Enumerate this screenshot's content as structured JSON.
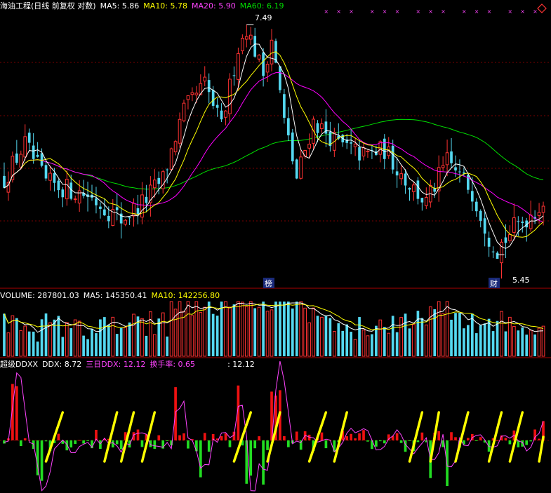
{
  "header": {
    "title": "海油工程(日线 前复权 对数)",
    "ma5": "MA5: 5.86",
    "ma10": "MA10: 5.78",
    "ma20": "MA20: 5.90",
    "ma60": "MA60: 6.19"
  },
  "volume_header": {
    "volume": "VOLUME: 287801.03",
    "ma5": "MA5: 145350.41",
    "ma10": "MA10: 142256.80"
  },
  "ddx_header": {
    "name": "超级DDXX",
    "ddx": "DDX: 8.72",
    "ddx3": "三日DDX: 12.12",
    "turnover": "换手率: 0.65",
    "extra": ": 12.12"
  },
  "annotations": {
    "high_label": "7.49",
    "low_label": "5.45",
    "tag_bang": "榜",
    "tag_cai": "财"
  },
  "colors": {
    "up": "#ff3232",
    "down": "#54d8f0",
    "ma5": "#ffffff",
    "ma10": "#ffff00",
    "ma20": "#ff00ff",
    "ma60": "#00e000",
    "ddx_pos": "#ee1111",
    "ddx_neg": "#22dd22",
    "ddx_line": "#ff44ff",
    "ddx_highlight": "#ffff00",
    "grid": "#7a0000",
    "text": "#ffffff"
  },
  "chart_data": [
    {
      "type": "candlestick",
      "title": "海油工程(日线 前复权 对数)",
      "yscale": "log",
      "ylim": [
        5.3,
        7.6
      ],
      "n_days": 130,
      "high_point": {
        "day": 58,
        "price": 7.49
      },
      "low_point": {
        "day": 118,
        "price": 5.45
      },
      "ma_lines": [
        "MA5",
        "MA10",
        "MA20",
        "MA60"
      ],
      "last": {
        "ma5": 5.86,
        "ma10": 5.78,
        "ma20": 5.9,
        "ma60": 6.19
      }
    },
    {
      "type": "bar",
      "title": "VOLUME",
      "last_volume": 287801.03,
      "ma5": 145350.41,
      "ma10": 142256.8
    },
    {
      "type": "bar",
      "title": "超级DDXX",
      "ddx": 8.72,
      "ddx3": 12.12,
      "turnover": 0.65
    }
  ]
}
